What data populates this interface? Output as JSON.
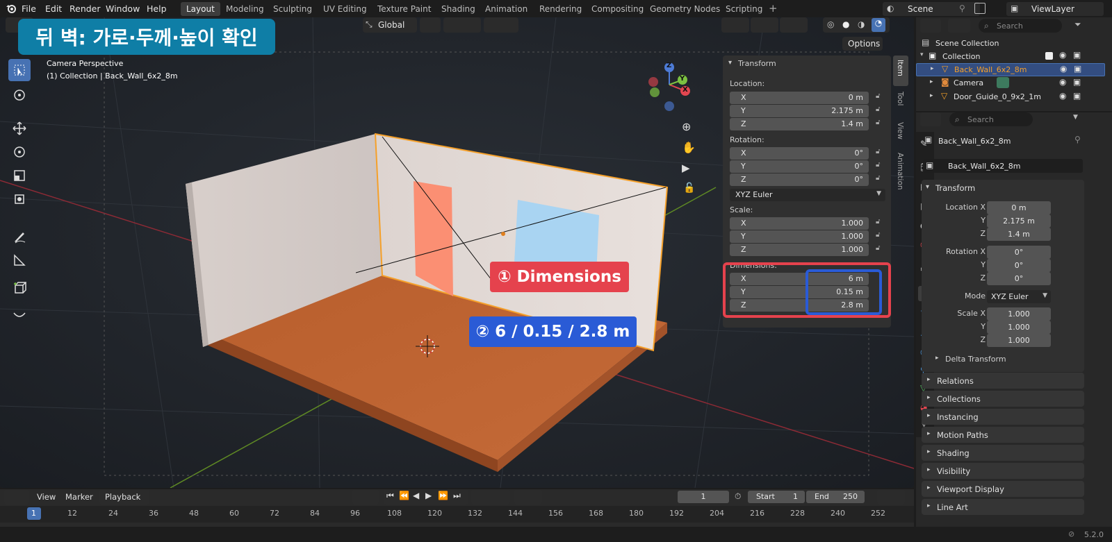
{
  "menu": [
    "File",
    "Edit",
    "Render",
    "Window",
    "Help"
  ],
  "workspaces": [
    "Layout",
    "Modeling",
    "Sculpting",
    "UV Editing",
    "Texture Paint",
    "Shading",
    "Animation",
    "Rendering",
    "Compositing",
    "Geometry Nodes",
    "Scripting"
  ],
  "scene": {
    "name": "Scene",
    "view_layer": "ViewLayer"
  },
  "viewport": {
    "orientation": "Global",
    "options_label": "Options",
    "camera_label": "Camera Perspective",
    "object_label": "(1) Collection | Back_Wall_6x2_8m",
    "title_callout": "뒤 벽: 가로·두께·높이 확인",
    "callout_dimensions": "① Dimensions",
    "callout_values": "② 6 / 0.15 / 2.8 m",
    "gizmo": {
      "x": "X",
      "y": "Y",
      "z": "Z"
    }
  },
  "npanel": {
    "tabs": [
      "Item",
      "Tool",
      "View",
      "Animation"
    ],
    "header": "Transform",
    "location_label": "Location:",
    "location": [
      {
        "axis": "X",
        "value": "0 m"
      },
      {
        "axis": "Y",
        "value": "2.175 m"
      },
      {
        "axis": "Z",
        "value": "1.4 m"
      }
    ],
    "rotation_label": "Rotation:",
    "rotation": [
      {
        "axis": "X",
        "value": "0°"
      },
      {
        "axis": "Y",
        "value": "0°"
      },
      {
        "axis": "Z",
        "value": "0°"
      }
    ],
    "rotation_mode": "XYZ Euler",
    "scale_label": "Scale:",
    "scale": [
      {
        "axis": "X",
        "value": "1.000"
      },
      {
        "axis": "Y",
        "value": "1.000"
      },
      {
        "axis": "Z",
        "value": "1.000"
      }
    ],
    "dimensions_label": "Dimensions:",
    "dimensions": [
      {
        "axis": "X",
        "value": "6 m"
      },
      {
        "axis": "Y",
        "value": "0.15 m"
      },
      {
        "axis": "Z",
        "value": "2.8 m"
      }
    ]
  },
  "outliner": {
    "search_placeholder": "Search",
    "scene_collection": "Scene Collection",
    "collection": "Collection",
    "items": [
      "Back_Wall_6x2_8m",
      "Camera",
      "Door_Guide_0_9x2_1m"
    ]
  },
  "properties": {
    "search_placeholder": "Search",
    "object_name": "Back_Wall_6x2_8m",
    "datablock_name": "Back_Wall_6x2_8m",
    "transform_header": "Transform",
    "location": [
      {
        "label": "Location X",
        "value": "0 m"
      },
      {
        "label": "Y",
        "value": "2.175 m"
      },
      {
        "label": "Z",
        "value": "1.4 m"
      }
    ],
    "rotation": [
      {
        "label": "Rotation X",
        "value": "0°"
      },
      {
        "label": "Y",
        "value": "0°"
      },
      {
        "label": "Z",
        "value": "0°"
      }
    ],
    "mode_label": "Mode",
    "mode_value": "XYZ Euler",
    "scale": [
      {
        "label": "Scale X",
        "value": "1.000"
      },
      {
        "label": "Y",
        "value": "1.000"
      },
      {
        "label": "Z",
        "value": "1.000"
      }
    ],
    "delta_transform": "Delta Transform",
    "panels": [
      "Relations",
      "Collections",
      "Instancing",
      "Motion Paths",
      "Shading",
      "Visibility",
      "Viewport Display",
      "Line Art"
    ]
  },
  "timeline": {
    "menus": [
      "View",
      "Marker",
      "Playback"
    ],
    "current_frame": "1",
    "start_label": "Start",
    "start": "1",
    "end_label": "End",
    "end": "250",
    "ruler": [
      "1",
      "12",
      "24",
      "36",
      "48",
      "60",
      "72",
      "84",
      "96",
      "108",
      "120",
      "132",
      "144",
      "156",
      "168",
      "180",
      "192",
      "204",
      "216",
      "228",
      "240",
      "252"
    ]
  },
  "status": {
    "version": "5.2.0"
  },
  "colors": {
    "accent": "#4772b3",
    "selected_orange": "#f5a02a",
    "callout_red": "#e5424d",
    "callout_blue": "#2a5bd6",
    "title_bg": "#0f7ea6"
  }
}
